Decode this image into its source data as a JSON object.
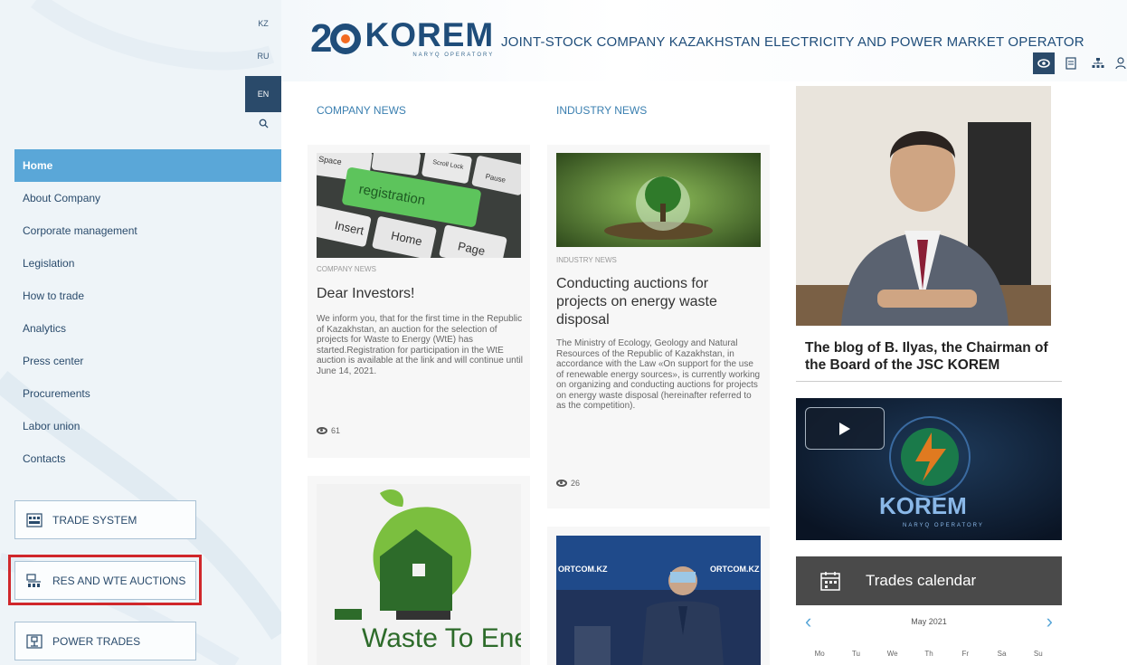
{
  "languages": [
    "KZ",
    "RU",
    "EN"
  ],
  "active_language": "EN",
  "nav": [
    {
      "label": "Home",
      "active": true
    },
    {
      "label": "About Company"
    },
    {
      "label": "Corporate management"
    },
    {
      "label": "Legislation"
    },
    {
      "label": "How to trade"
    },
    {
      "label": "Analytics"
    },
    {
      "label": "Press center"
    },
    {
      "label": "Procurements"
    },
    {
      "label": "Labor union"
    },
    {
      "label": "Contacts"
    }
  ],
  "side_buttons": {
    "trade_system": "TRADE SYSTEM",
    "res_wte": "RES AND WTE AUCTIONS",
    "power_trades": "POWER TRADES"
  },
  "header": {
    "logo_main": "KOREM",
    "logo_sub": "NARYQ OPERATORY",
    "title": "JOINT-STOCK COMPANY KAZAKHSTAN ELECTRICITY AND POWER MARKET OPERATOR"
  },
  "company_news": {
    "heading": "COMPANY NEWS",
    "cards": [
      {
        "category": "COMPANY NEWS",
        "title": "Dear Investors!",
        "text": "We inform you, that for the first time in the Republic of Kazakhstan, an auction for the selection of projects for Waste to Energy (WtE) has started.Registration for participation in the WtE auction is available at the link and will continue until June 14, 2021.",
        "views": "61",
        "image_keys": [
          "Space",
          "Scroll Lock",
          "Pause",
          "registration",
          "Insert",
          "Home",
          "Page"
        ]
      },
      {
        "image_text": "Waste To Energy"
      }
    ]
  },
  "industry_news": {
    "heading": "INDUSTRY NEWS",
    "cards": [
      {
        "category": "INDUSTRY NEWS",
        "title": "Conducting auctions for projects on energy waste disposal",
        "text": "The Ministry of Ecology, Geology and Natural Resources of the Republic of Kazakhstan, in accordance with the Law «On support for the use of renewable energy sources», is currently working on organizing and conducting auctions for projects on energy waste disposal (hereinafter referred to as the competition).",
        "views": "26"
      },
      {
        "image_text": "ORTCOM.KZ"
      }
    ]
  },
  "blog": {
    "title": "The blog of B. Ilyas, the Chairman of the Board of the JSC KOREM"
  },
  "video": {
    "brand": "KOREM",
    "sub": "NARYQ OPERATORY"
  },
  "calendar": {
    "title": "Trades calendar",
    "month": "May 2021",
    "weekdays": [
      "Mo",
      "Tu",
      "We",
      "Th",
      "Fr",
      "Sa",
      "Su"
    ]
  },
  "colors": {
    "accent": "#5aa7d8",
    "brand": "#1f4d7a",
    "highlight": "#d0272b",
    "calendar_bar": "#4a4a4a"
  }
}
